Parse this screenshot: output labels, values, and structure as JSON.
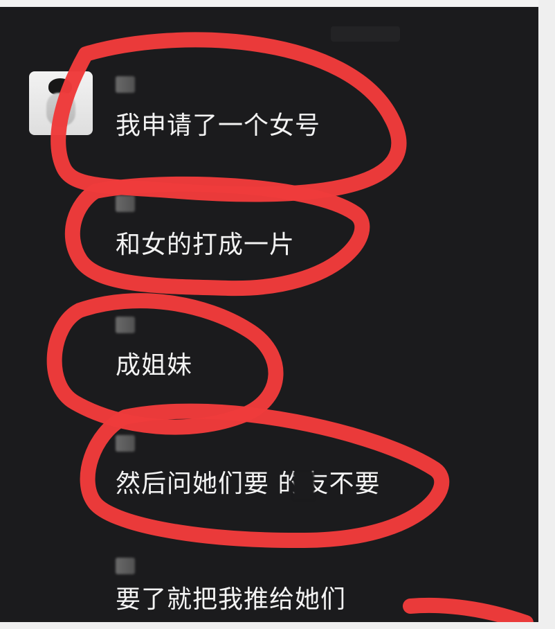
{
  "chat": {
    "messages": [
      {
        "text": "我申请了一个女号"
      },
      {
        "text": "和女的打成一片"
      },
      {
        "text": "成姐妹"
      },
      {
        "text": "然后问她们要 的友不要"
      },
      {
        "text": "要了就把我推给她们"
      }
    ]
  },
  "annotations": {
    "color": "#ef3b3b"
  }
}
